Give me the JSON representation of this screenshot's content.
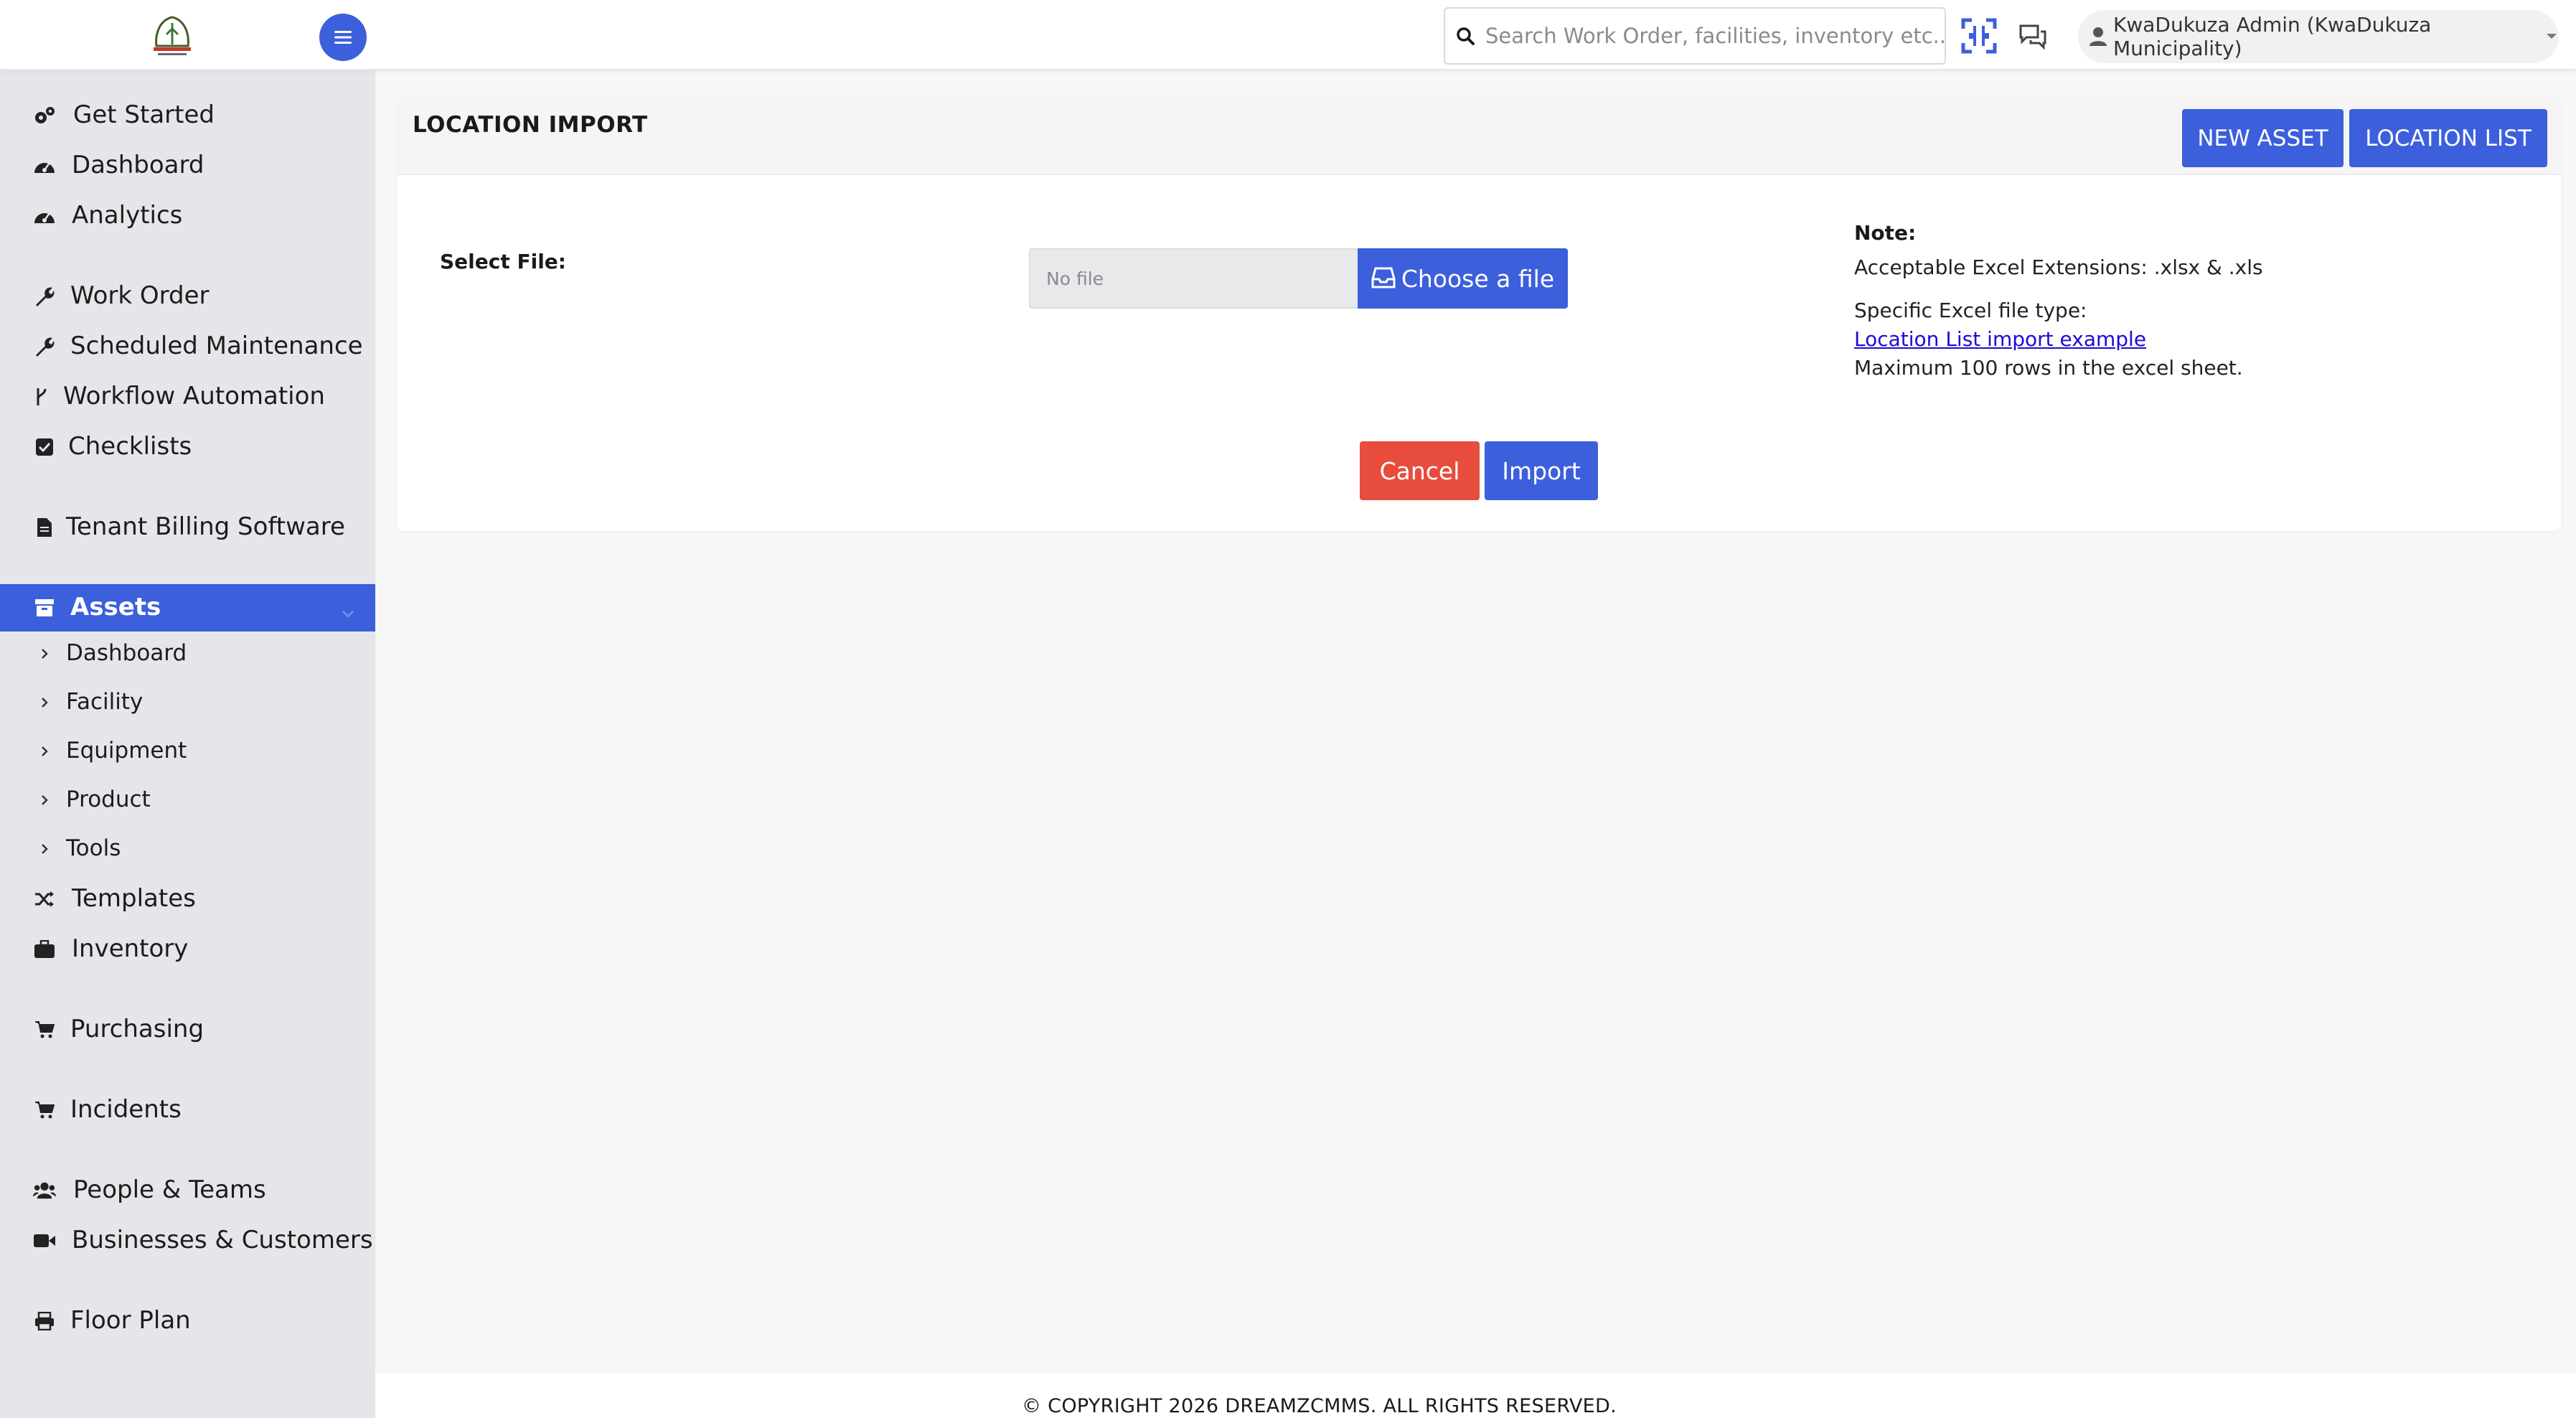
{
  "colors": {
    "primary": "#3c5fdc",
    "danger": "#e84c3d",
    "link": "#1a0dd6",
    "sidebar_bg": "#e6e6ea"
  },
  "header": {
    "search_placeholder": "Search Work Order, facilities, inventory etc...",
    "user_label": "KwaDukuza Admin (KwaDukuza Municipality)"
  },
  "sidebar": {
    "items": [
      {
        "label": "Get Started",
        "icon": "cogs-icon"
      },
      {
        "label": "Dashboard",
        "icon": "dashboard-gauge-icon"
      },
      {
        "label": "Analytics",
        "icon": "analytics-gauge-icon"
      },
      {
        "label": "Work Order",
        "icon": "wrench-icon"
      },
      {
        "label": "Scheduled Maintenance",
        "icon": "wrench-icon"
      },
      {
        "label": "Workflow Automation",
        "icon": "branch-icon"
      },
      {
        "label": "Checklists",
        "icon": "checkbox-icon"
      },
      {
        "label": "Tenant Billing Software",
        "icon": "document-icon"
      },
      {
        "label": "Assets",
        "icon": "archive-icon"
      },
      {
        "label": "Templates",
        "icon": "shuffle-icon"
      },
      {
        "label": "Inventory",
        "icon": "briefcase-icon"
      },
      {
        "label": "Purchasing",
        "icon": "cart-icon"
      },
      {
        "label": "Incidents",
        "icon": "cart-icon"
      },
      {
        "label": "People & Teams",
        "icon": "users-icon"
      },
      {
        "label": "Businesses & Customers",
        "icon": "video-icon"
      },
      {
        "label": "Floor Plan",
        "icon": "print-icon"
      }
    ],
    "assets_subitems": [
      "Dashboard",
      "Facility",
      "Equipment",
      "Product",
      "Tools"
    ]
  },
  "main": {
    "title": "LOCATION IMPORT",
    "new_asset_label": "NEW ASSET",
    "location_list_label": "LOCATION LIST",
    "select_file_label": "Select File:",
    "file_placeholder": "No file",
    "choose_file_label": "Choose a file",
    "note": {
      "title": "Note:",
      "extensions": "Acceptable Excel Extensions: .xlsx & .xls",
      "file_type": "Specific Excel file type:",
      "example_link": "Location List import example",
      "max_rows": "Maximum 100 rows in the excel sheet."
    },
    "cancel_label": "Cancel",
    "import_label": "Import"
  },
  "footer": {
    "copyright": "© COPYRIGHT 2026 DREAMZCMMS. ALL RIGHTS RESERVED."
  }
}
